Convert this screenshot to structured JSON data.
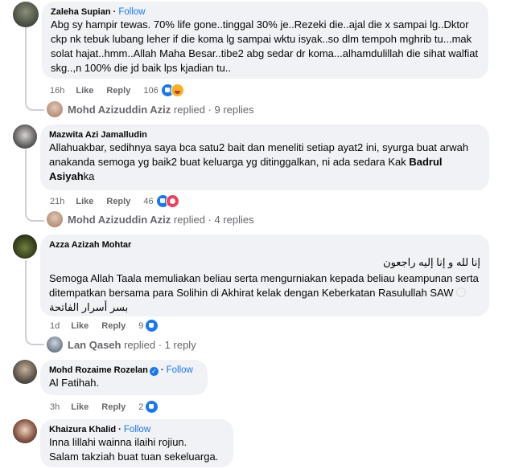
{
  "comments": [
    {
      "name": "Zaleha Supian",
      "follow": "Follow",
      "text": "Abg sy hampir tewas. 70% life gone..tinggal 30% je..Rezeki die..ajal die x sampai lg..Dktor ckp nk tebuk lubang leher if die koma lg sampai wktu isyak..so dlm tempoh mghrib tu...mak solat hajat..hmm..Allah Maha Besar..tibe2 abg sedar dr koma...alhamdulillah die sihat walfiat skg..,n 100% die jd baik lps kjadian tu..",
      "time": "16h",
      "like": "Like",
      "reply": "Reply",
      "reactions": "106",
      "replies_by": "Mohd Azizuddin Aziz",
      "replies_text": "replied · 9 replies"
    },
    {
      "name": "Mazwita Azi Jamalludin",
      "text_part1": "Allahuakbar, sedihnya saya bca satu2 bait dan meneliti setiap ayat2 ini, syurga buat arwah anakanda semoga yg baik2 buat keluarga yg ditinggalkan, ni ada sedara Kak ",
      "text_bold": "Badrul Asiyah",
      "text_part2": "ka",
      "time": "21h",
      "like": "Like",
      "reply": "Reply",
      "reactions": "46",
      "replies_by": "Mohd Azizuddin Aziz",
      "replies_text": "replied · 4 replies"
    },
    {
      "name": "Azza Azizah Mohtar",
      "arabic_line": "إنا لله و إنا إليه راجعون",
      "text": "Semoga Allah Taala memuliakan beliau serta mengurniakan kepada beliau keampunan serta ditempatkan bersama para Solihin di Akhirat kelak dengan Keberkatan Rasulullah SAW",
      "arabic_tail": "بسر أسرار الفاتحة",
      "time": "1d",
      "like": "Like",
      "reply": "Reply",
      "reactions": "9",
      "replies_by": "Lan Qaseh",
      "replies_text": "replied · 1 reply"
    },
    {
      "name": "Mohd Rozaime Rozelan",
      "follow": "Follow",
      "text": "Al Fatihah.",
      "time": "3h",
      "like": "Like",
      "reply": "Reply",
      "reactions": "2"
    },
    {
      "name": "Khaizura Khalid",
      "follow": "Follow",
      "text_line1": "Inna lillahi wainna ilaihi rojiun.",
      "text_line2": "Salam takziah buat tuan sekeluarga."
    }
  ],
  "colors": {
    "follow": "#1877f2",
    "bubble": "#f0f2f5",
    "meta": "#65676b",
    "like_reaction": "#1877f2",
    "love_reaction": "#f33e58",
    "haha_reaction": "#f7b125"
  }
}
